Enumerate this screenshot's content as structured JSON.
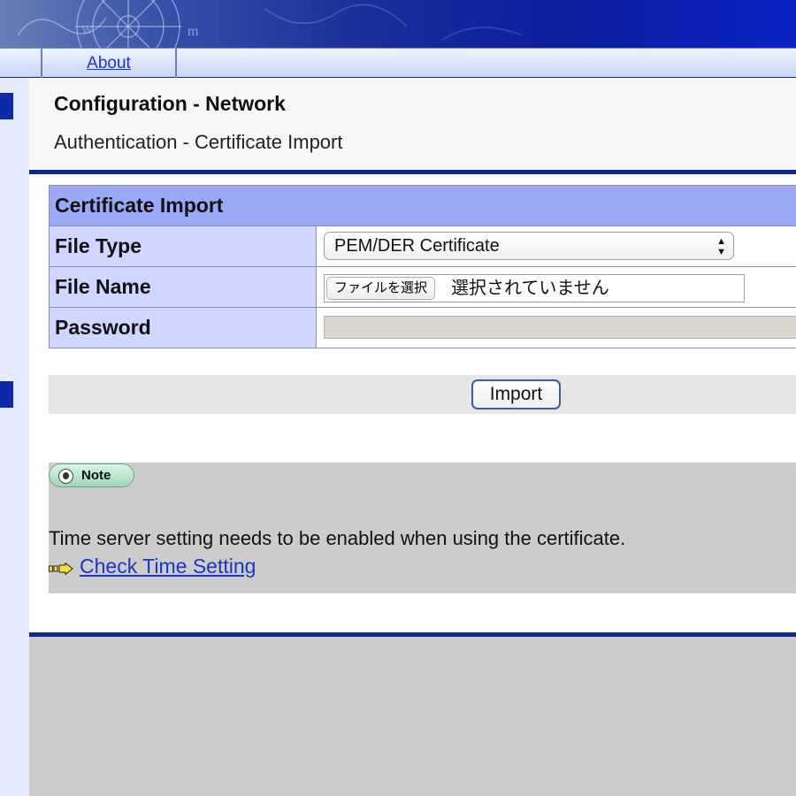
{
  "nav": {
    "about_label": "About"
  },
  "page": {
    "title": "Configuration - Network",
    "subtitle": "Authentication - Certificate Import"
  },
  "form": {
    "header": "Certificate Import",
    "file_type": {
      "label": "File Type",
      "selected": "PEM/DER Certificate"
    },
    "file_name": {
      "label": "File Name",
      "button_label": "ファイルを選択",
      "status_text": "選択されていません"
    },
    "password": {
      "label": "Password",
      "value": ""
    }
  },
  "actions": {
    "import_label": "Import"
  },
  "note": {
    "badge_label": "Note",
    "text": "Time server setting needs to be enabled when using the certificate.",
    "link_label": "Check Time Setting"
  },
  "colors": {
    "banner": "#0c1f9c",
    "form_header_bg": "#9aa8f5",
    "form_label_bg": "#cfd6ff",
    "rule": "#0d2a95",
    "link": "#1a35c7"
  },
  "icons": {
    "note": "lightbulb-icon",
    "link": "arrow-right-icon",
    "select": "updown-arrows-icon"
  }
}
